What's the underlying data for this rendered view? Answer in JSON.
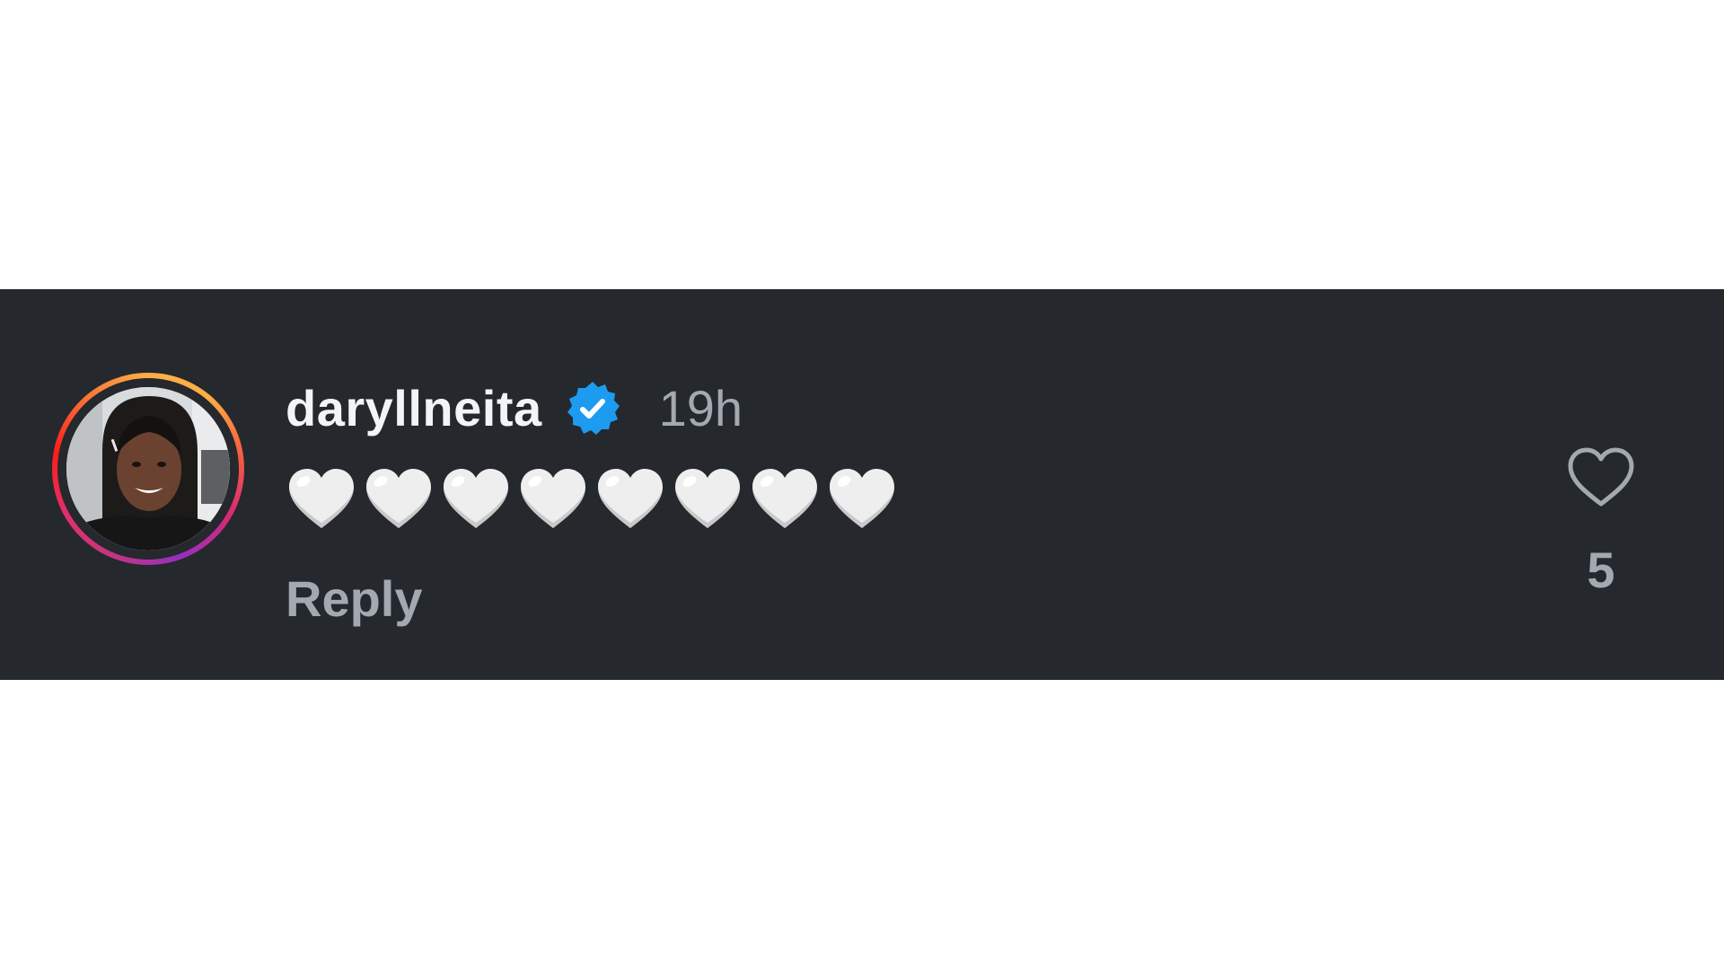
{
  "comment": {
    "username": "daryllneita",
    "timestamp": "19h",
    "text": "🤍🤍🤍🤍🤍🤍🤍🤍",
    "reply_label": "Reply",
    "like_count": "5",
    "verified": true
  },
  "icons": {
    "verified": "verified-badge-icon",
    "like": "heart-outline-icon",
    "emoji": "white-heart-emoji"
  },
  "colors": {
    "panel_background": "#25282d",
    "username": "#f3f4f6",
    "secondary_text": "#a3a9b1",
    "verified_blue": "#1d9bf0"
  }
}
